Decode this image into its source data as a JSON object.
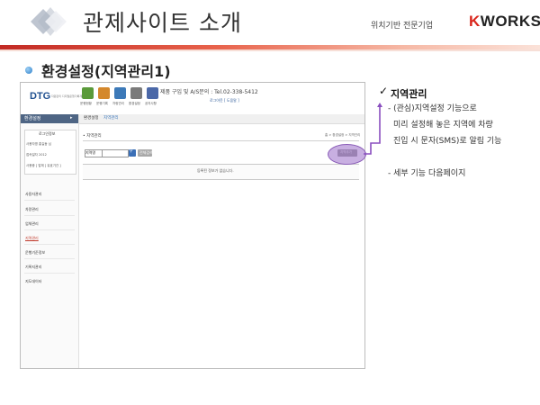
{
  "slide": {
    "title": "관제사이트 소개",
    "tagline": "위치기반 전문기업",
    "brand_k": "K",
    "brand_rest": "WORKS",
    "section_title": "환경설정(지역관리1)"
  },
  "screenshot": {
    "logo": "DTG",
    "logo_sub": "자원관리 디지털운행기록계",
    "toolbar_icons": [
      {
        "label": "운행현황",
        "color": "#5a9a3a"
      },
      {
        "label": "운행기록",
        "color": "#d4882c"
      },
      {
        "label": "차량관리",
        "color": "#3c79b8"
      },
      {
        "label": "환경설정",
        "color": "#7a7a7a"
      },
      {
        "label": "공지사항",
        "color": "#4b68a8"
      }
    ],
    "contact": "제품 구입 및 A/S문의 : Tel.02-338-5412",
    "contact_sub": "로그아웃 [ 도움말 ]",
    "sidebar": {
      "header": "환경설정",
      "login_title": "로그인정보",
      "login_rows": [
        "사용자명  홍길동 님",
        "접속일자  2012",
        "사용중 [ 업체 ] 유효기간 ]"
      ],
      "menu": [
        "사용자관리",
        "차량관리",
        "업체관리",
        "지역관리",
        "운행기준정보",
        "기록지관리",
        "지도데이터"
      ],
      "active_index": 3
    },
    "tabs": [
      "환경설정",
      "지역관리"
    ],
    "crumb_title": "• 지역관리",
    "crumb_path": "홈 > 환경설정 > 지역관리",
    "select_value": "지역명",
    "reset_label": "전체검색",
    "add_label": "지역추가",
    "empty_message": "등록된 정보가 없습니다."
  },
  "notes": {
    "heading": "지역관리",
    "lines": [
      "- (관심)지역설정 기능으로",
      "미리 설정해 놓은 지역에 차량",
      "진입 시 문자(SMS)로 알림 기능",
      "- 세부 기능 다음페이지"
    ]
  },
  "colors": {
    "accent_red": "#c22a24",
    "highlight_purple": "#9b6ec8",
    "sidebar_header": "#4e6584"
  }
}
